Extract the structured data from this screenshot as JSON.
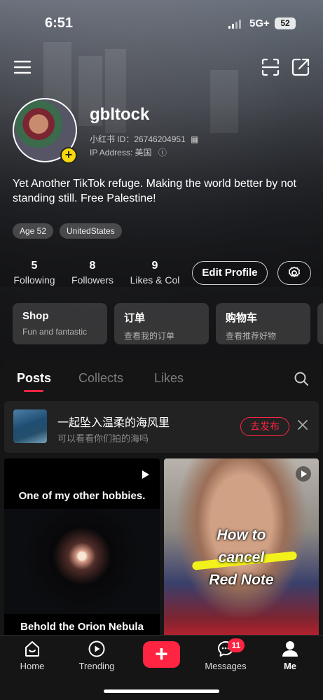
{
  "status_bar": {
    "time": "6:51",
    "network": "5G+",
    "battery": "52"
  },
  "profile": {
    "username": "gbltock",
    "id_line": "小红书 ID：26746204951",
    "ip_line": "IP Address: 美国",
    "bio": "Yet Another TikTok refuge. Making the world better by not standing still. Free Palestine!",
    "tags": [
      "Age 52",
      "UnitedStates"
    ]
  },
  "stats": [
    {
      "num": "5",
      "label": "Following"
    },
    {
      "num": "8",
      "label": "Followers"
    },
    {
      "num": "9",
      "label": "Likes & Col"
    }
  ],
  "buttons": {
    "edit_profile": "Edit Profile"
  },
  "cards": [
    {
      "title": "Shop",
      "subtitle": "Fun and fantastic"
    },
    {
      "title": "订单",
      "subtitle": "查看我的订单"
    },
    {
      "title": "购物车",
      "subtitle": "查看推荐好物"
    }
  ],
  "tabs": [
    "Posts",
    "Collects",
    "Likes"
  ],
  "prompt": {
    "title": "一起坠入温柔的海风里",
    "subtitle": "可以看看你们拍的海吗",
    "action": "去发布"
  },
  "posts": [
    {
      "caption_top": "One of my other hobbies.",
      "caption_bottom": "Behold the Orion Nebula"
    },
    {
      "caption_lines": [
        "How to",
        "cancel",
        "Red Note"
      ]
    }
  ],
  "nav": {
    "home": "Home",
    "trending": "Trending",
    "messages": "Messages",
    "messages_badge": "11",
    "me": "Me",
    "post_symbol": "+"
  },
  "colors": {
    "accent": "#ff2442",
    "plus_badge": "#f5d90a"
  }
}
